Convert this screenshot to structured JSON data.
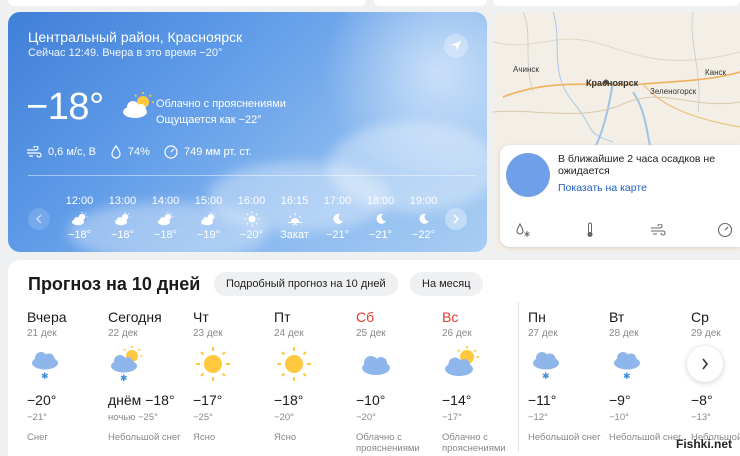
{
  "now": {
    "location": "Центральный район, Красноярск",
    "subline": "Сейчас 12:49. Вчера в это время −20°",
    "temp": "−18°",
    "condition": "Облачно с прояснениями",
    "feels_like": "Ощущается как −22°",
    "wind": "0,6 м/с, В",
    "humidity": "74%",
    "pressure": "749 мм рт. ст.",
    "icons": {
      "nav": "location-arrow-icon",
      "wind": "wind-icon",
      "humidity": "drop-icon",
      "pressure": "gauge-icon"
    }
  },
  "hours": [
    {
      "time": "12:00",
      "temp": "−18°",
      "icon": "partly-cloudy-icon"
    },
    {
      "time": "13:00",
      "temp": "−18°",
      "icon": "partly-cloudy-icon"
    },
    {
      "time": "14:00",
      "temp": "−18°",
      "icon": "partly-cloudy-icon"
    },
    {
      "time": "15:00",
      "temp": "−19°",
      "icon": "partly-cloudy-icon"
    },
    {
      "time": "16:00",
      "temp": "−20°",
      "icon": "sun-icon"
    },
    {
      "time": "16:15",
      "temp": "Закат",
      "icon": "sunset-icon"
    },
    {
      "time": "17:00",
      "temp": "−21°",
      "icon": "moon-icon"
    },
    {
      "time": "18:00",
      "temp": "−21°",
      "icon": "moon-icon"
    },
    {
      "time": "19:00",
      "temp": "−22°",
      "icon": "moon-icon"
    }
  ],
  "map": {
    "labels": {
      "achinsk": "Ачинск",
      "krasnoyarsk": "Красноярск",
      "zelenogorsk": "Зеленогорск",
      "kansk": "Канск"
    },
    "precip_message": "В ближайшие 2 часа осадков не ожидается",
    "show_on_map": "Показать на карте",
    "tools": [
      "precipitation-icon",
      "thermometer-icon",
      "wind-icon",
      "gauge-icon"
    ]
  },
  "forecast": {
    "title": "Прогноз на 10 дней",
    "detailed_btn": "Подробный прогноз на 10 дней",
    "month_btn": "На месяц",
    "days": [
      {
        "name": "Вчера",
        "date": "21 дек",
        "hi": "−20°",
        "lo": "−21°",
        "cond": "Снег",
        "icon": "cloud-snow-icon",
        "weekend": false
      },
      {
        "name": "Сегодня",
        "date": "22 дек",
        "hi": "днём −18°",
        "lo": "ночью −25°",
        "cond": "Небольшой снег",
        "icon": "sun-cloud-snow-icon",
        "weekend": false
      },
      {
        "name": "Чт",
        "date": "23 дек",
        "hi": "−17°",
        "lo": "−25°",
        "cond": "Ясно",
        "icon": "sun-icon",
        "weekend": false
      },
      {
        "name": "Пт",
        "date": "24 дек",
        "hi": "−18°",
        "lo": "−20°",
        "cond": "Ясно",
        "icon": "sun-icon",
        "weekend": false
      },
      {
        "name": "Сб",
        "date": "25 дек",
        "hi": "−10°",
        "lo": "−20°",
        "cond": "Облачно с прояснениями",
        "icon": "cloud-icon",
        "weekend": true
      },
      {
        "name": "Вс",
        "date": "26 дек",
        "hi": "−14°",
        "lo": "−17°",
        "cond": "Облачно с прояснениями",
        "icon": "sun-cloud-icon",
        "weekend": true
      },
      {
        "name": "Пн",
        "date": "27 дек",
        "hi": "−11°",
        "lo": "−12°",
        "cond": "Небольшой снег",
        "icon": "cloud-snow-icon",
        "weekend": false
      },
      {
        "name": "Вт",
        "date": "28 дек",
        "hi": "−9°",
        "lo": "−10°",
        "cond": "Небольшой снег",
        "icon": "cloud-snow-icon",
        "weekend": false
      },
      {
        "name": "Ср",
        "date": "29 дек",
        "hi": "−8°",
        "lo": "−13°",
        "cond": "Небольшой",
        "icon": "cloud-snow-icon",
        "weekend": false
      }
    ]
  },
  "watermark": "Fishki.net",
  "colors": {
    "accent": "#1f5fbf",
    "weekend": "#e23b2e",
    "sun": "#ffc83d",
    "card_blue": "#5f9be8"
  }
}
